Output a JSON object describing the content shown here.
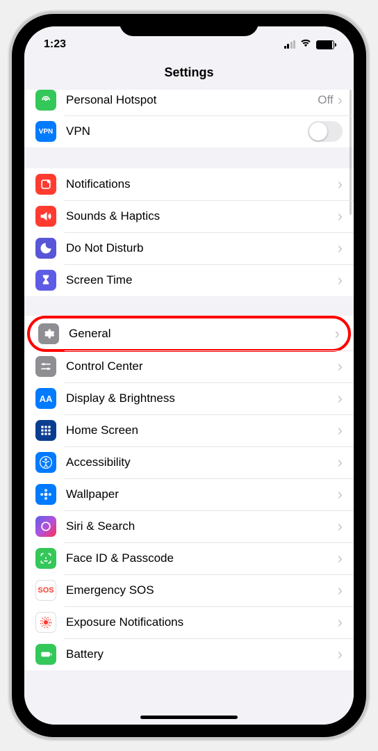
{
  "status": {
    "time": "1:23"
  },
  "title": "Settings",
  "sections": [
    {
      "rows": [
        {
          "key": "personal-hotspot",
          "label": "Personal Hotspot",
          "value": "Off",
          "cutoff": true
        },
        {
          "key": "vpn",
          "label": "VPN",
          "toggle": true,
          "iconText": "VPN"
        }
      ]
    },
    {
      "rows": [
        {
          "key": "notifications",
          "label": "Notifications"
        },
        {
          "key": "sounds-haptics",
          "label": "Sounds & Haptics"
        },
        {
          "key": "do-not-disturb",
          "label": "Do Not Disturb"
        },
        {
          "key": "screen-time",
          "label": "Screen Time"
        }
      ]
    },
    {
      "rows": [
        {
          "key": "general",
          "label": "General",
          "highlighted": true
        },
        {
          "key": "control-center",
          "label": "Control Center"
        },
        {
          "key": "display-brightness",
          "label": "Display & Brightness",
          "iconText": "AA"
        },
        {
          "key": "home-screen",
          "label": "Home Screen"
        },
        {
          "key": "accessibility",
          "label": "Accessibility"
        },
        {
          "key": "wallpaper",
          "label": "Wallpaper"
        },
        {
          "key": "siri-search",
          "label": "Siri & Search"
        },
        {
          "key": "face-id-passcode",
          "label": "Face ID & Passcode"
        },
        {
          "key": "emergency-sos",
          "label": "Emergency SOS",
          "iconText": "SOS"
        },
        {
          "key": "exposure-notifications",
          "label": "Exposure Notifications"
        },
        {
          "key": "battery",
          "label": "Battery"
        }
      ]
    }
  ]
}
